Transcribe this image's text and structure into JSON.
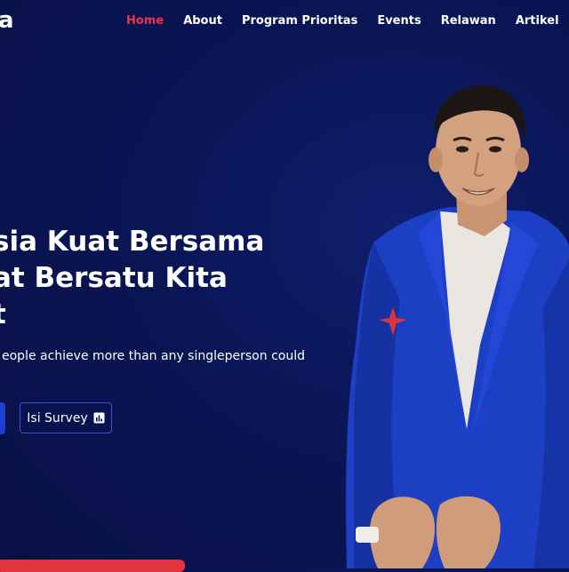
{
  "brand": {
    "logo_text": "a"
  },
  "nav": {
    "items": [
      {
        "label": "Home",
        "active": true
      },
      {
        "label": "About"
      },
      {
        "label": "Program Prioritas"
      },
      {
        "label": "Events"
      },
      {
        "label": "Relawan"
      },
      {
        "label": "Artikel"
      }
    ]
  },
  "hero": {
    "title": "sia Kuat Bersama\nat Bersatu Kita\nt",
    "subtitle": "eople achieve more than any singleperson could",
    "survey_button_label": "Isi Survey",
    "survey_icon": "bar-chart-icon"
  },
  "colors": {
    "background": "#0a1554",
    "accent_red": "#e8334f",
    "primary_blue": "#1f3ed0",
    "suit_blue": "#1c3fc4"
  }
}
